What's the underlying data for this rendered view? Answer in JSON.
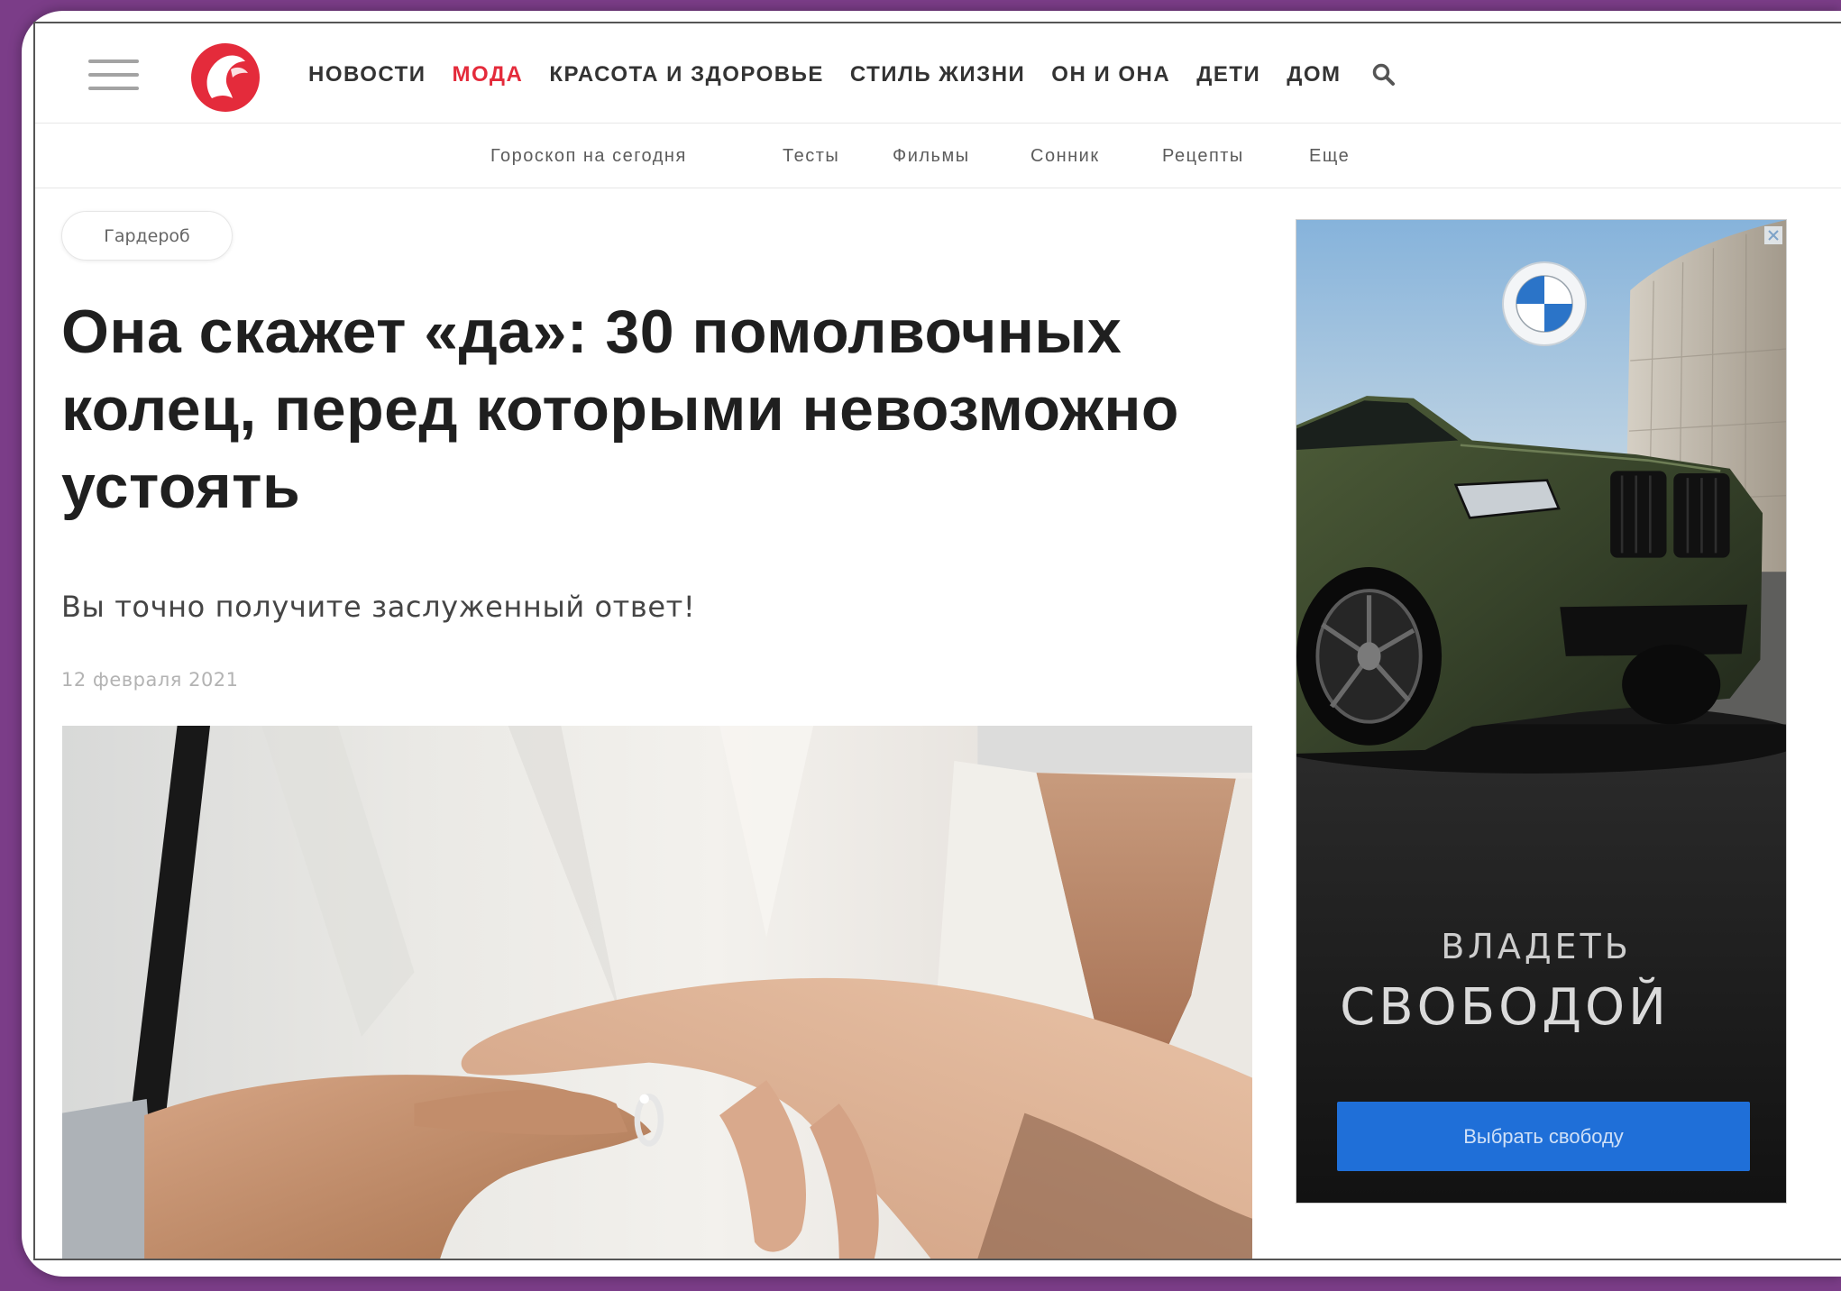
{
  "colors": {
    "frame_background": "#7b3d88",
    "brand_red": "#e42b3b",
    "nav_active": "#e42b3b",
    "ad_button": "#1f6fd8"
  },
  "icons": {
    "menu": "hamburger-icon",
    "logo": "site-logo",
    "search": "search-icon",
    "ad_close": "close-icon",
    "ad_brand": "bmw-logo"
  },
  "header": {
    "nav": [
      {
        "label": "НОВОСТИ",
        "active": false
      },
      {
        "label": "МОДА",
        "active": true
      },
      {
        "label": "КРАСОТА И ЗДОРОВЬЕ",
        "active": false
      },
      {
        "label": "СТИЛЬ ЖИЗНИ",
        "active": false
      },
      {
        "label": "ОН И ОНА",
        "active": false
      },
      {
        "label": "ДЕТИ",
        "active": false
      },
      {
        "label": "ДОМ",
        "active": false
      }
    ],
    "subnav": [
      "Гороскоп на сегодня",
      "Тесты",
      "Фильмы",
      "Сонник",
      "Рецепты",
      "Еще"
    ]
  },
  "article": {
    "tag": "Гардероб",
    "title": "Она скажет «да»: 30 помолвочных колец, перед которыми невозможно устоять",
    "lead": "Вы точно получите заслуженный ответ!",
    "date": "12 февраля 2021"
  },
  "ad": {
    "headline_top": "ВЛАДЕТЬ",
    "headline_main": "СВОБОДОЙ",
    "cta_label": "Выбрать свободу"
  }
}
